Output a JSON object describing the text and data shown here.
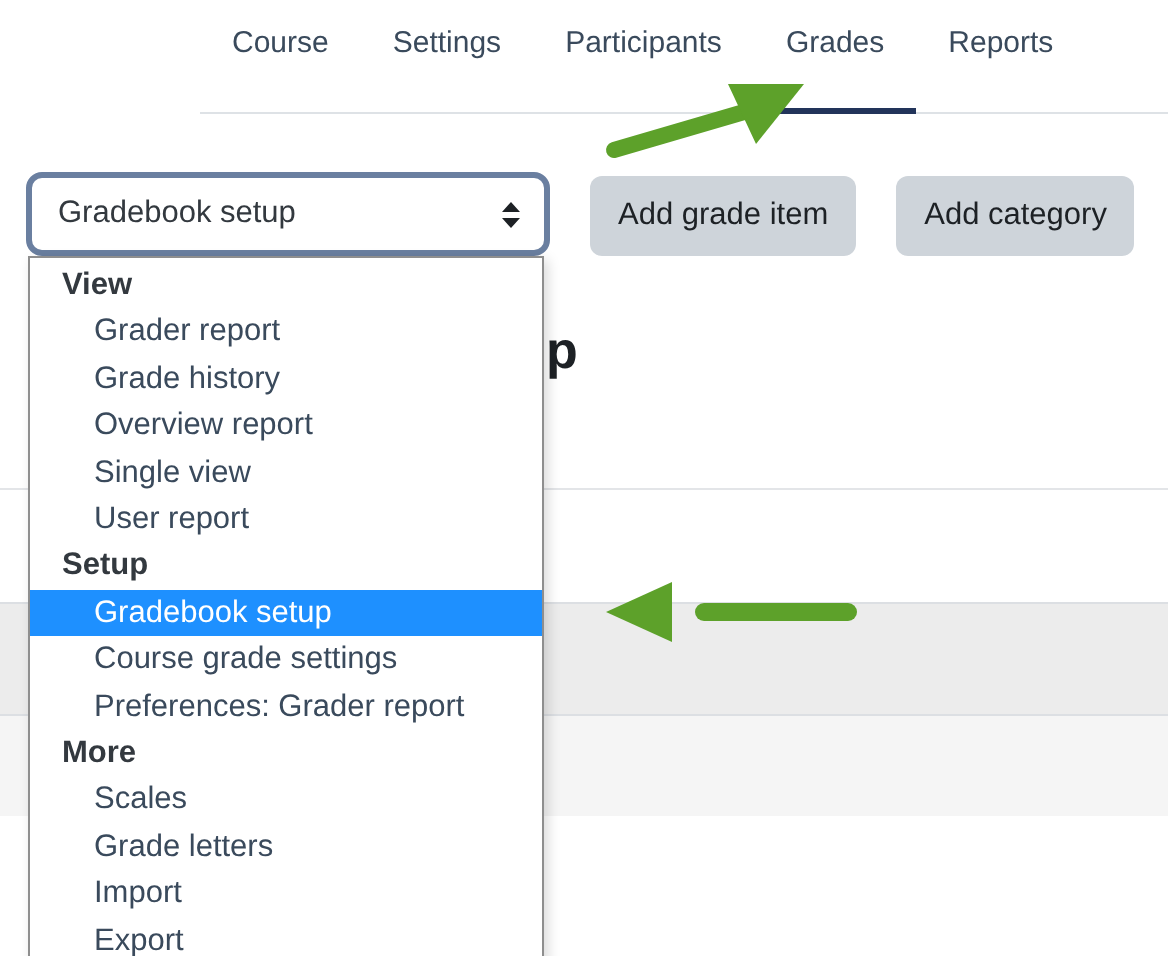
{
  "tabs": [
    {
      "label": "Course",
      "selected": false
    },
    {
      "label": "Settings",
      "selected": false
    },
    {
      "label": "Participants",
      "selected": false
    },
    {
      "label": "Grades",
      "selected": true
    },
    {
      "label": "Reports",
      "selected": false
    }
  ],
  "select": {
    "value": "Gradebook setup"
  },
  "buttons": [
    "Add grade item",
    "Add category"
  ],
  "page_heading": "p",
  "dropdown": {
    "groups": [
      {
        "label": "View",
        "items": [
          {
            "label": "Grader report",
            "selected": false
          },
          {
            "label": "Grade history",
            "selected": false
          },
          {
            "label": "Overview report",
            "selected": false
          },
          {
            "label": "Single view",
            "selected": false
          },
          {
            "label": "User report",
            "selected": false
          }
        ]
      },
      {
        "label": "Setup",
        "items": [
          {
            "label": "Gradebook setup",
            "selected": true
          },
          {
            "label": "Course grade settings",
            "selected": false
          },
          {
            "label": "Preferences: Grader report",
            "selected": false
          }
        ]
      },
      {
        "label": "More",
        "items": [
          {
            "label": "Scales",
            "selected": false
          },
          {
            "label": "Grade letters",
            "selected": false
          },
          {
            "label": "Import",
            "selected": false
          },
          {
            "label": "Export",
            "selected": false
          }
        ]
      }
    ]
  }
}
